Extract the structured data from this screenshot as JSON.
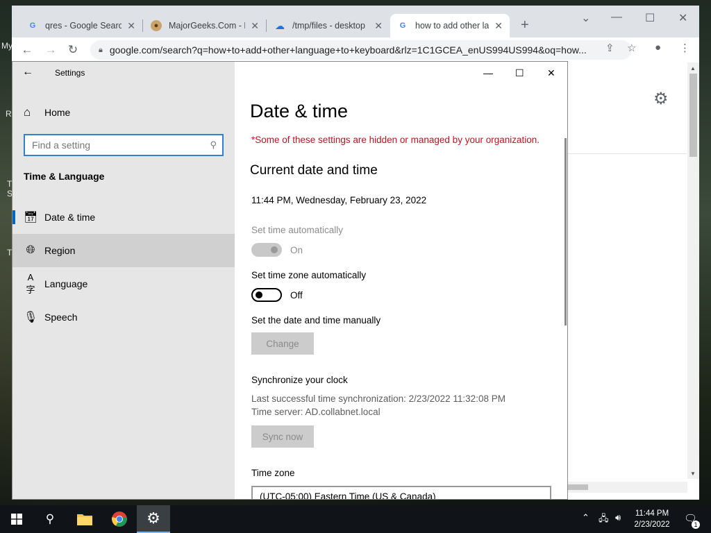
{
  "desktop": {
    "fragments": [
      "My",
      "R",
      "T",
      "S",
      "T"
    ]
  },
  "browser": {
    "tabs": [
      {
        "title": "qres - Google Search",
        "favicon": "google-g-icon"
      },
      {
        "title": "MajorGeeks.Com - M",
        "favicon": "majorgeeks-icon"
      },
      {
        "title": "/tmp/files - desktop",
        "favicon": "cloud-drive-icon"
      },
      {
        "title": "how to add other lan",
        "favicon": "google-g-icon",
        "active": true
      }
    ],
    "url": "google.com/search?q=how+to+add+other+language+to+keyboard&rlz=1C1GCEA_enUS994US994&oq=how..."
  },
  "settings": {
    "app_title": "Settings",
    "home_label": "Home",
    "search_placeholder": "Find a setting",
    "section_heading": "Time & Language",
    "nav_items": [
      {
        "label": "Date & time",
        "icon": "calendar-clock-icon",
        "selected": true
      },
      {
        "label": "Region",
        "icon": "globe-icon",
        "hover": true
      },
      {
        "label": "Language",
        "icon": "language-icon"
      },
      {
        "label": "Speech",
        "icon": "microphone-icon"
      }
    ],
    "page_title": "Date & time",
    "org_warning": "*Some of these settings are hidden or managed by your organization.",
    "current_heading": "Current date and time",
    "current_datetime": "11:44 PM, Wednesday, February 23, 2022",
    "set_time_auto_label": "Set time automatically",
    "set_time_auto_state": "On",
    "set_tz_auto_label": "Set time zone automatically",
    "set_tz_auto_state": "Off",
    "manual_label": "Set the date and time manually",
    "change_button": "Change",
    "sync_heading": "Synchronize your clock",
    "last_sync": "Last successful time synchronization: 2/23/2022 11:32:08 PM",
    "time_server": "Time server: AD.collabnet.local",
    "sync_button": "Sync now",
    "timezone_label": "Time zone",
    "timezone_value": "(UTC-05:00) Eastern Time (US & Canada)",
    "warning_color": "#c50f1f",
    "accent_color": "#0067c0"
  },
  "taskbar": {
    "time": "11:44 PM",
    "date": "2/23/2022",
    "notification_count": "1"
  }
}
